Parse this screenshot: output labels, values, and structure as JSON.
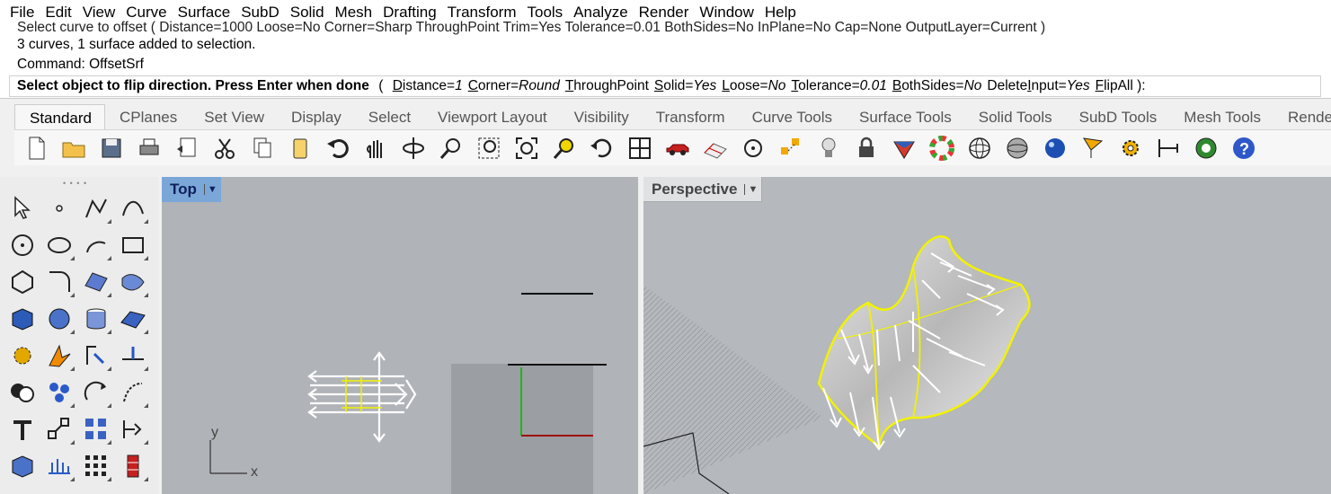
{
  "menu": [
    "File",
    "Edit",
    "View",
    "Curve",
    "Surface",
    "SubD",
    "Solid",
    "Mesh",
    "Drafting",
    "Transform",
    "Tools",
    "Analyze",
    "Render",
    "Window",
    "Help"
  ],
  "command_history": {
    "cutoff_line": "Select curve to offset ( Distance=1000  Loose=No  Corner=Sharp  ThroughPoint  Trim=Yes  Tolerance=0.01  BothSides=No  InPlane=No  Cap=None  OutputLayer=Current )",
    "line2": "3 curves, 1 surface added to selection.",
    "line3": "Command: OffsetSrf"
  },
  "prompt": {
    "text": "Select object to flip direction. Press Enter when done",
    "open": "(",
    "close": "):",
    "options": [
      {
        "pre": "",
        "u": "D",
        "post": "istance=",
        "val": "1"
      },
      {
        "pre": "",
        "u": "C",
        "post": "orner=",
        "val": "Round"
      },
      {
        "pre": "",
        "u": "T",
        "post": "hroughPoint",
        "val": ""
      },
      {
        "pre": "",
        "u": "S",
        "post": "olid=",
        "val": "Yes"
      },
      {
        "pre": "",
        "u": "L",
        "post": "oose=",
        "val": "No"
      },
      {
        "pre": "",
        "u": "T",
        "post": "olerance=",
        "val": "0.01"
      },
      {
        "pre": "",
        "u": "B",
        "post": "othSides=",
        "val": "No"
      },
      {
        "pre": "Delete",
        "u": "I",
        "post": "nput=",
        "val": "Yes"
      },
      {
        "pre": "",
        "u": "F",
        "post": "lipAll",
        "val": ""
      }
    ]
  },
  "tabs": [
    "Standard",
    "CPlanes",
    "Set View",
    "Display",
    "Select",
    "Viewport Layout",
    "Visibility",
    "Transform",
    "Curve Tools",
    "Surface Tools",
    "Solid Tools",
    "SubD Tools",
    "Mesh Tools",
    "Render"
  ],
  "active_tab": "Standard",
  "toolbar_icons": [
    "new-file-icon",
    "open-folder-icon",
    "save-icon",
    "print-icon",
    "import-icon",
    "cut-icon",
    "copy-icon",
    "paste-icon",
    "undo-icon",
    "pan-hand-icon",
    "rotate-view-icon",
    "zoom-icon",
    "zoom-window-icon",
    "zoom-extents-icon",
    "zoom-selected-icon",
    "undo-view-icon",
    "four-viewports-icon",
    "car-icon",
    "grid-options-icon",
    "osnap-icon",
    "gumball-icon",
    "light-bulb-icon",
    "lock-icon",
    "material-icon",
    "color-wheel-icon",
    "wireframe-sphere-icon",
    "shaded-sphere-icon",
    "rendered-sphere-icon",
    "flag-icon",
    "gear-icon",
    "dimension-icon",
    "display-globe-icon",
    "help-icon"
  ],
  "toolbox_icons": [
    "select-arrow-icon",
    "point-icon",
    "polyline-icon",
    "curve-icon",
    "circle-icon",
    "ellipse-icon",
    "arc-icon",
    "rectangle-icon",
    "polygon-icon",
    "fillet-curve-icon",
    "surface-from-curves-icon",
    "surface-patch-icon",
    "box-icon",
    "sphere-icon",
    "cylinder-icon",
    "mesh-plane-icon",
    "transform-gear-icon",
    "explode-icon",
    "extend-icon",
    "trim-icon",
    "boolean-icon",
    "group-icon",
    "rotate-icon",
    "curve-tools-icon",
    "text-icon",
    "scale-icon",
    "array-icon",
    "dimension-tool-icon",
    "solid-box-icon",
    "grid-points-icon",
    "grid-array-icon",
    "wall-icon"
  ],
  "viewports": {
    "top": {
      "label": "Top",
      "axis_x": "x",
      "axis_y": "y"
    },
    "perspective": {
      "label": "Perspective"
    }
  },
  "colors": {
    "active_viewport_label": "#7aa7d8",
    "selection_yellow": "#f2f200",
    "background": "#b4b7bb"
  }
}
